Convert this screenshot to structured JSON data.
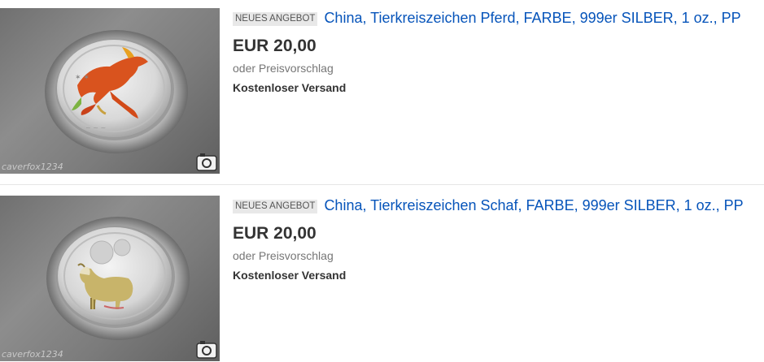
{
  "listings": [
    {
      "badge": "NEUES ANGEBOT",
      "title": "China, Tierkreiszeichen Pferd, FARBE, 999er SILBER, 1 oz., PP",
      "price": "EUR 20,00",
      "offer": "oder Preisvorschlag",
      "shipping": "Kostenloser Versand",
      "watermark": "caverfox1234",
      "image": "horse-coin-image"
    },
    {
      "badge": "NEUES ANGEBOT",
      "title": "China, Tierkreiszeichen Schaf, FARBE, 999er SILBER, 1 oz., PP",
      "price": "EUR 20,00",
      "offer": "oder Preisvorschlag",
      "shipping": "Kostenloser Versand",
      "watermark": "caverfox1234",
      "image": "sheep-coin-image"
    }
  ],
  "colors": {
    "link": "#0654ba",
    "badge_bg": "#e8e8e8",
    "price": "#333333",
    "muted": "#767676"
  }
}
